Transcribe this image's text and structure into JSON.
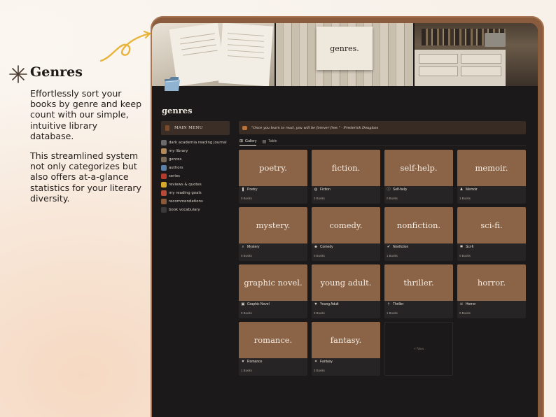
{
  "promo": {
    "title": "Genres",
    "paragraph1": "Effortlessly sort your books by genre and keep count with our simple, intuitive library database.",
    "paragraph2": "This streamlined system not only categorizes but also offers at-a-glance statistics for your literary diversity."
  },
  "banner": {
    "note_text": "genres."
  },
  "page": {
    "title": "genres"
  },
  "sidebar": {
    "header": "MAIN MENU",
    "items": [
      {
        "label": "dark academia reading journal",
        "icon": "book-icon",
        "color": "#6b6b6b"
      },
      {
        "label": "my library",
        "icon": "books-icon",
        "color": "#b48a5a"
      },
      {
        "label": "genres",
        "icon": "folder-icon",
        "color": "#7a6a55"
      },
      {
        "label": "authors",
        "icon": "quill-icon",
        "color": "#5a7fa8"
      },
      {
        "label": "series",
        "icon": "red-book-icon",
        "color": "#b23a2f"
      },
      {
        "label": "reviews & quotes",
        "icon": "star-icon",
        "color": "#d6a92a"
      },
      {
        "label": "my reading goals",
        "icon": "target-icon",
        "color": "#b84a3a"
      },
      {
        "label": "recommendations",
        "icon": "heart-icon",
        "color": "#8c5a3a"
      },
      {
        "label": "book vocabulary",
        "icon": "mortarboard-icon",
        "color": "#3a3a3a"
      }
    ]
  },
  "quote": {
    "text": "\"Once you learn to read, you will be forever free.\" - Frederick Douglass"
  },
  "tabs": [
    {
      "label": "Gallery",
      "active": true
    },
    {
      "label": "Table",
      "active": false
    }
  ],
  "genres": [
    {
      "cover": "poetry.",
      "name": "Poetry",
      "count": "0 Books",
      "icon": "bookmark-icon",
      "glyph": "❚"
    },
    {
      "cover": "fiction.",
      "name": "Fiction",
      "count": "3 Books",
      "icon": "globe-icon",
      "glyph": "◍"
    },
    {
      "cover": "self-help.",
      "name": "Self-help",
      "count": "0 Books",
      "icon": "info-icon",
      "glyph": "ⓘ"
    },
    {
      "cover": "memoir.",
      "name": "Memoir",
      "count": "1 Books",
      "icon": "person-icon",
      "glyph": "♟"
    },
    {
      "cover": "mystery.",
      "name": "Mystery",
      "count": "0 Books",
      "icon": "magnifier-icon",
      "glyph": "⌕"
    },
    {
      "cover": "comedy.",
      "name": "Comedy",
      "count": "0 Books",
      "icon": "smiley-icon",
      "glyph": "☻"
    },
    {
      "cover": "nonfiction.",
      "name": "Nonfiction",
      "count": "1 Books",
      "icon": "check-circle-icon",
      "glyph": "✔"
    },
    {
      "cover": "sci-fi.",
      "name": "Sci-fi",
      "count": "0 Books",
      "icon": "atom-icon",
      "glyph": "✱"
    },
    {
      "cover": "graphic novel.",
      "name": "Graphic Novel",
      "count": "0 Books",
      "icon": "image-icon",
      "glyph": "▣"
    },
    {
      "cover": "young adult.",
      "name": "Young Adult",
      "count": "3 Books",
      "icon": "cap-icon",
      "glyph": "▼"
    },
    {
      "cover": "thriller.",
      "name": "Thriller",
      "count": "1 Books",
      "icon": "dagger-icon",
      "glyph": "†"
    },
    {
      "cover": "horror.",
      "name": "Horror",
      "count": "0 Books",
      "icon": "skull-icon",
      "glyph": "☠"
    },
    {
      "cover": "romance.",
      "name": "Romance",
      "count": "1 Books",
      "icon": "heart-icon",
      "glyph": "♥"
    },
    {
      "cover": "fantasy.",
      "name": "Fantasy",
      "count": "3 Books",
      "icon": "wand-icon",
      "glyph": "✦"
    }
  ],
  "new_button": "+ New",
  "colors": {
    "cover": "#8b6346",
    "frame": "#8a5c3d",
    "screen": "#1b1919",
    "accent_arrow": "#e9b43a"
  }
}
